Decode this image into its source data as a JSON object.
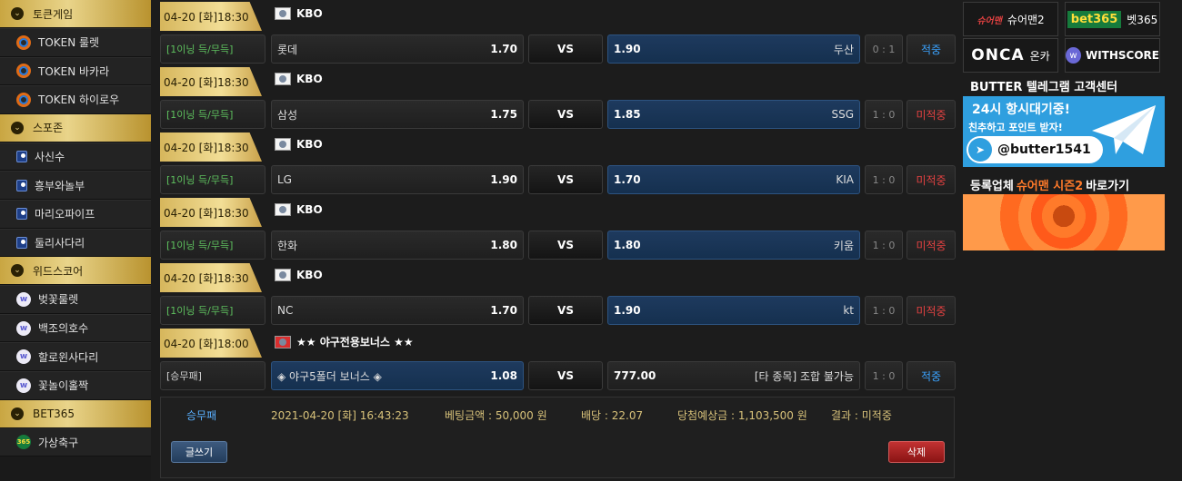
{
  "sidebar": {
    "sections": [
      {
        "title": "토큰게임",
        "items": [
          {
            "label": "TOKEN 룰렛",
            "icon": "token-icon"
          },
          {
            "label": "TOKEN 바카라",
            "icon": "token-icon"
          },
          {
            "label": "TOKEN 하이로우",
            "icon": "token-icon"
          }
        ]
      },
      {
        "title": "스포존",
        "items": [
          {
            "label": "사신수",
            "icon": "cube-icon"
          },
          {
            "label": "흥부와놀부",
            "icon": "cube-icon"
          },
          {
            "label": "마리오파이프",
            "icon": "cube-icon"
          },
          {
            "label": "둘리사다리",
            "icon": "cube-icon"
          }
        ]
      },
      {
        "title": "위드스코어",
        "items": [
          {
            "label": "벚꽃룰렛",
            "icon": "withscore-icon"
          },
          {
            "label": "백조의호수",
            "icon": "withscore-icon"
          },
          {
            "label": "할로윈사다리",
            "icon": "withscore-icon"
          },
          {
            "label": "꽃놀이홀짝",
            "icon": "withscore-icon"
          }
        ]
      },
      {
        "title": "BET365",
        "items": [
          {
            "label": "가상축구",
            "icon": "bet365-icon"
          }
        ]
      }
    ]
  },
  "games": [
    {
      "date": "04-20 [화]18:30",
      "league": "KBO",
      "type": "[1이닝 득/무득]",
      "home": "롯데",
      "home_odds": "1.70",
      "vs": "VS",
      "away_odds": "1.90",
      "away": "두산",
      "score": "0 : 1",
      "result": "적중",
      "result_status": "hit",
      "selected": "away"
    },
    {
      "date": "04-20 [화]18:30",
      "league": "KBO",
      "type": "[1이닝 득/무득]",
      "home": "삼성",
      "home_odds": "1.75",
      "vs": "VS",
      "away_odds": "1.85",
      "away": "SSG",
      "score": "1 : 0",
      "result": "미적중",
      "result_status": "miss",
      "selected": "away"
    },
    {
      "date": "04-20 [화]18:30",
      "league": "KBO",
      "type": "[1이닝 득/무득]",
      "home": "LG",
      "home_odds": "1.90",
      "vs": "VS",
      "away_odds": "1.70",
      "away": "KIA",
      "score": "1 : 0",
      "result": "미적중",
      "result_status": "miss",
      "selected": "away"
    },
    {
      "date": "04-20 [화]18:30",
      "league": "KBO",
      "type": "[1이닝 득/무득]",
      "home": "한화",
      "home_odds": "1.80",
      "vs": "VS",
      "away_odds": "1.80",
      "away": "키움",
      "score": "1 : 0",
      "result": "미적중",
      "result_status": "miss",
      "selected": "away"
    },
    {
      "date": "04-20 [화]18:30",
      "league": "KBO",
      "type": "[1이닝 득/무득]",
      "home": "NC",
      "home_odds": "1.70",
      "vs": "VS",
      "away_odds": "1.90",
      "away": "kt",
      "score": "1 : 0",
      "result": "미적중",
      "result_status": "miss",
      "selected": "away"
    },
    {
      "date": "04-20 [화]18:00",
      "league": "★★ 야구전용보너스 ★★",
      "type": "[승무패]",
      "home": "◈ 야구5폴더 보너스 ◈",
      "home_odds": "1.08",
      "vs": "VS",
      "away_odds": "777.00",
      "away": "[타 종목] 조합 불가능",
      "score": "1 : 0",
      "result": "적중",
      "result_status": "hit",
      "selected": "home"
    }
  ],
  "summary": {
    "type": "승무패",
    "datetime": "2021-04-20 [화] 16:43:23",
    "bet_amount": "베팅금액 : 50,000 원",
    "odds": "배당 : 22.07",
    "expected": "당첨예상금 : 1,103,500 원",
    "result": "결과 : 미적중",
    "write_button": "글쓰기",
    "delete_button": "삭제"
  },
  "right": {
    "partners": [
      {
        "mark": "슈어맨",
        "label": "슈어맨2"
      },
      {
        "mark": "bet365",
        "label": "벳365"
      },
      {
        "mark": "ONCA",
        "label": "온카"
      },
      {
        "mark": "w",
        "label": "WITHSCORE"
      }
    ],
    "telegram": {
      "title": "BUTTER 텔레그램 고객센터",
      "line1": "24시 항시대기중!",
      "line2": "친추하고 포인트 받자!",
      "handle": "@butter1541"
    },
    "register": {
      "prefix": "등록업체",
      "highlight": "슈어맨 시즌2",
      "suffix": "바로가기"
    }
  },
  "colors": {
    "gold": "#e9d48a",
    "hit": "#3aa3ff",
    "miss": "#e24141",
    "selected": "#1e3a5e"
  }
}
